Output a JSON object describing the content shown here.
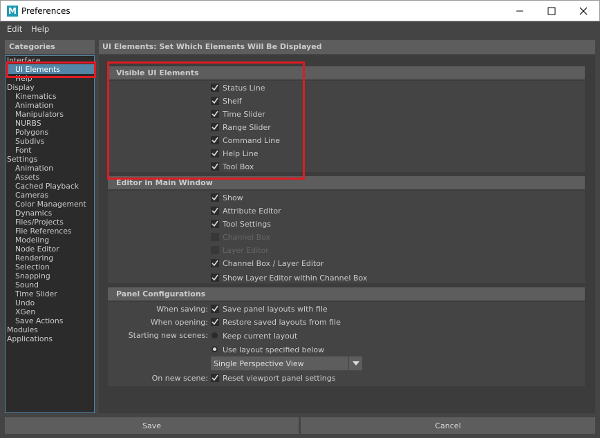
{
  "window": {
    "title": "Preferences",
    "icon_letter": "M",
    "accent_color": "#5285a6",
    "highlight_color": "#e01b23"
  },
  "menu": [
    "Edit",
    "Help"
  ],
  "categories": {
    "header": "Categories",
    "items": [
      {
        "label": "Interface",
        "indent": false
      },
      {
        "label": "UI Elements",
        "indent": true,
        "selected": true
      },
      {
        "label": "Help",
        "indent": true
      },
      {
        "label": "Display",
        "indent": false
      },
      {
        "label": "Kinematics",
        "indent": true
      },
      {
        "label": "Animation",
        "indent": true
      },
      {
        "label": "Manipulators",
        "indent": true
      },
      {
        "label": "NURBS",
        "indent": true
      },
      {
        "label": "Polygons",
        "indent": true
      },
      {
        "label": "Subdivs",
        "indent": true
      },
      {
        "label": "Font",
        "indent": true
      },
      {
        "label": "Settings",
        "indent": false
      },
      {
        "label": "Animation",
        "indent": true
      },
      {
        "label": "Assets",
        "indent": true
      },
      {
        "label": "Cached Playback",
        "indent": true
      },
      {
        "label": "Cameras",
        "indent": true
      },
      {
        "label": "Color Management",
        "indent": true
      },
      {
        "label": "Dynamics",
        "indent": true
      },
      {
        "label": "Files/Projects",
        "indent": true
      },
      {
        "label": "File References",
        "indent": true
      },
      {
        "label": "Modeling",
        "indent": true
      },
      {
        "label": "Node Editor",
        "indent": true
      },
      {
        "label": "Rendering",
        "indent": true
      },
      {
        "label": "Selection",
        "indent": true
      },
      {
        "label": "Snapping",
        "indent": true
      },
      {
        "label": "Sound",
        "indent": true
      },
      {
        "label": "Time Slider",
        "indent": true
      },
      {
        "label": "Undo",
        "indent": true
      },
      {
        "label": "XGen",
        "indent": true
      },
      {
        "label": "Save Actions",
        "indent": true
      },
      {
        "label": "Modules",
        "indent": false
      },
      {
        "label": "Applications",
        "indent": false
      }
    ]
  },
  "main": {
    "header": "UI Elements: Set Which Elements Will Be Displayed"
  },
  "visible_ui": {
    "title": "Visible UI Elements",
    "items": [
      {
        "label": "Status Line",
        "checked": true
      },
      {
        "label": "Shelf",
        "checked": true
      },
      {
        "label": "Time Slider",
        "checked": true
      },
      {
        "label": "Range Slider",
        "checked": true
      },
      {
        "label": "Command Line",
        "checked": true
      },
      {
        "label": "Help Line",
        "checked": true
      },
      {
        "label": "Tool Box",
        "checked": true
      }
    ]
  },
  "editor_main": {
    "title": "Editor in Main Window",
    "items": [
      {
        "label": "Show",
        "checked": true,
        "enabled": true
      },
      {
        "label": "Attribute Editor",
        "checked": true,
        "enabled": true
      },
      {
        "label": "Tool Settings",
        "checked": true,
        "enabled": true
      },
      {
        "label": "Channel Box",
        "checked": false,
        "enabled": false
      },
      {
        "label": "Layer Editor",
        "checked": false,
        "enabled": false
      },
      {
        "label": "Channel Box / Layer Editor",
        "checked": true,
        "enabled": true
      },
      {
        "label": "Show Layer Editor within Channel Box",
        "checked": true,
        "enabled": true
      }
    ]
  },
  "panel_config": {
    "title": "Panel Configurations",
    "when_saving_label": "When saving:",
    "when_saving_option": "Save panel layouts with file",
    "when_opening_label": "When opening:",
    "when_opening_option": "Restore saved layouts from file",
    "starting_label": "Starting new scenes:",
    "starting_options": [
      "Keep current layout",
      "Use layout specified below"
    ],
    "starting_selected": 1,
    "layout_select": "Single Perspective View",
    "on_new_label": "On new scene:",
    "on_new_option": "Reset viewport panel settings"
  },
  "buttons": {
    "save": "Save",
    "cancel": "Cancel"
  }
}
